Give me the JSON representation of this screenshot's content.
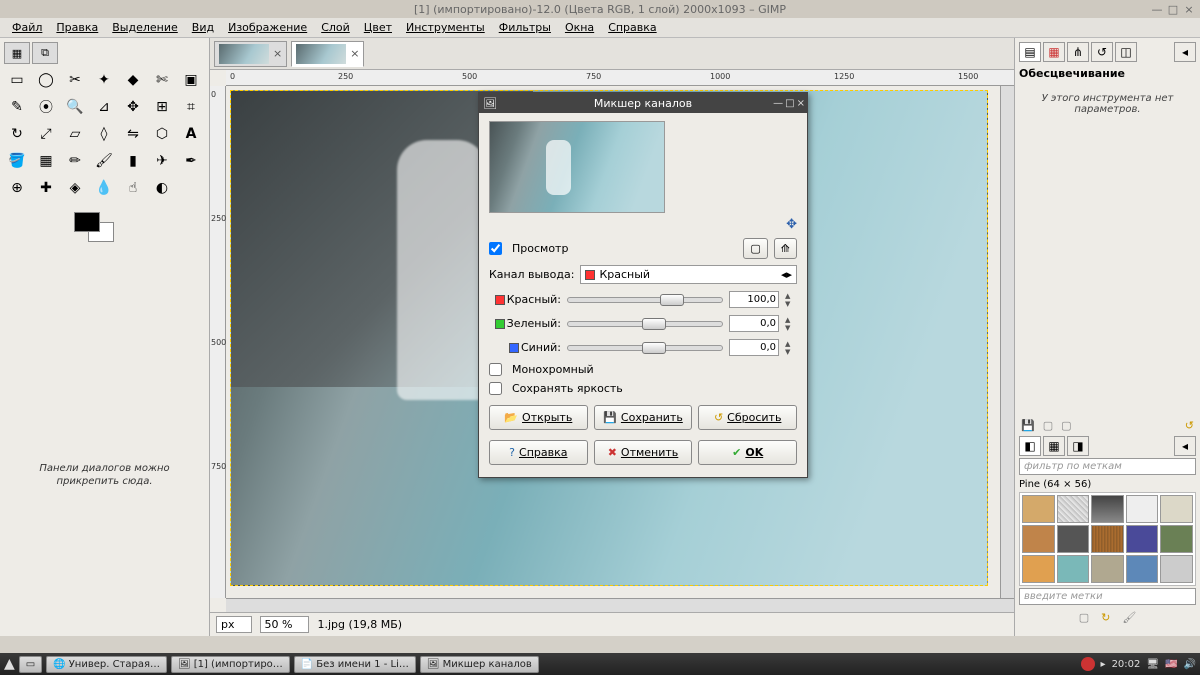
{
  "title": "[1] (импортировано)-12.0 (Цвета RGB, 1 слой) 2000x1093 – GIMP",
  "menu": {
    "file": "Файл",
    "edit": "Правка",
    "select": "Выделение",
    "view": "Вид",
    "image": "Изображение",
    "layer": "Слой",
    "colors": "Цвет",
    "tools": "Инструменты",
    "filters": "Фильтры",
    "windows": "Окна",
    "help": "Справка"
  },
  "dock_hint": "Панели диалогов можно прикрепить сюда.",
  "ruler_h": [
    "0",
    "250",
    "500",
    "750",
    "1000",
    "1250",
    "1500"
  ],
  "ruler_v": [
    "0",
    "250",
    "500",
    "750"
  ],
  "status": {
    "unit": "px",
    "zoom": "50 %",
    "file": "1.jpg (19,8 МБ)"
  },
  "right": {
    "title": "Обесцвечивание",
    "empty": "У этого инструмента нет параметров.",
    "filter_ph": "фильтр по меткам",
    "dim": "Pine (64 × 56)",
    "tags_ph": "введите метки"
  },
  "dialog": {
    "title": "Микшер каналов",
    "preview": "Просмотр",
    "out_channel_lbl": "Канал вывода:",
    "out_channel_val": "Красный",
    "red": "Красный:",
    "green": "Зеленый:",
    "blue": "Синий:",
    "red_val": "100,0",
    "green_val": "0,0",
    "blue_val": "0,0",
    "mono": "Монохромный",
    "preserve": "Сохранять яркость",
    "open": "Открыть",
    "save": "Сохранить",
    "reset": "Сбросить",
    "help": "Справка",
    "cancel": "Отменить",
    "ok": "OK"
  },
  "taskbar": {
    "t1": "Универ. Старая…",
    "t2": "[1] (импортиро…",
    "t3": "Без имени 1 - Li…",
    "t4": "Микшер каналов",
    "time": "20:02"
  }
}
